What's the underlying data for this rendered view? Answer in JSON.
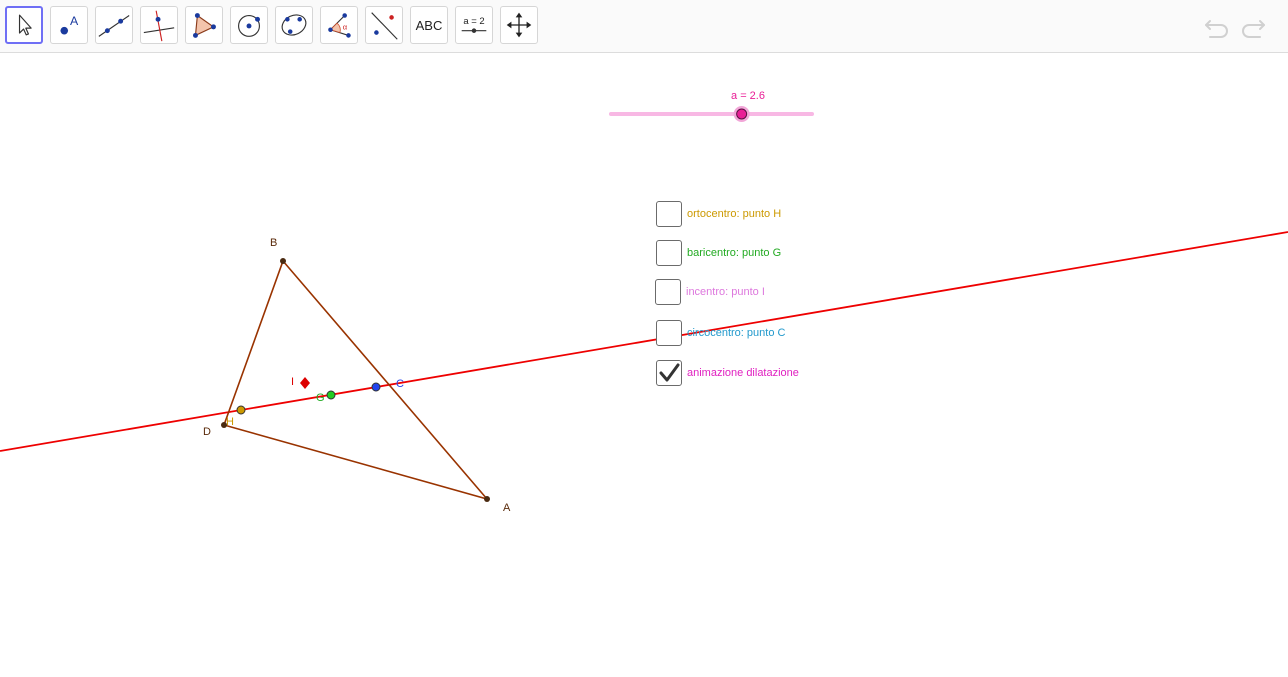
{
  "toolbar": {
    "tools": [
      {
        "name": "move-tool",
        "selected": true
      },
      {
        "name": "point-tool",
        "label": "A"
      },
      {
        "name": "line-tool"
      },
      {
        "name": "perpendicular-line-tool"
      },
      {
        "name": "polygon-tool"
      },
      {
        "name": "circle-tool"
      },
      {
        "name": "conic-tool"
      },
      {
        "name": "angle-tool",
        "label": "α"
      },
      {
        "name": "reflect-tool"
      },
      {
        "name": "text-tool",
        "label": "ABC"
      },
      {
        "name": "slider-tool",
        "label": "a = 2"
      },
      {
        "name": "move-graphics-view-tool"
      }
    ],
    "undo_icon": "undo-icon",
    "redo_icon": "redo-icon"
  },
  "slider": {
    "label": "a = 2.6",
    "min": 0,
    "max": 4,
    "value": 2.6,
    "color": "#e91e96",
    "track_color": "#f8b8e4"
  },
  "checkboxes": [
    {
      "label": "ortocentro: punto H",
      "color": "#cc9900",
      "checked": false
    },
    {
      "label": "baricentro: punto G",
      "color": "#22aa22",
      "checked": false
    },
    {
      "label": "incentro: punto I",
      "color": "#dd77dd",
      "checked": false
    },
    {
      "label": "circocentro: punto C",
      "color": "#2299cc",
      "checked": false
    },
    {
      "label": "animazione dilatazione",
      "color": "#e020c0",
      "checked": true
    }
  ],
  "geometry": {
    "points": {
      "B": {
        "label": "B",
        "color": "#5a2a0a"
      },
      "A": {
        "label": "A",
        "color": "#5a2a0a"
      },
      "D": {
        "label": "D",
        "color": "#5a2a0a"
      },
      "H": {
        "label": "H",
        "color": "#cc9900"
      },
      "G": {
        "label": "G",
        "color": "#22aa22"
      },
      "C": {
        "label": "C",
        "color": "#2244ee"
      },
      "I": {
        "label": "I",
        "color": "#dd0000"
      }
    },
    "triangle_color": "#993300",
    "euler_line_color": "#ee0000"
  }
}
